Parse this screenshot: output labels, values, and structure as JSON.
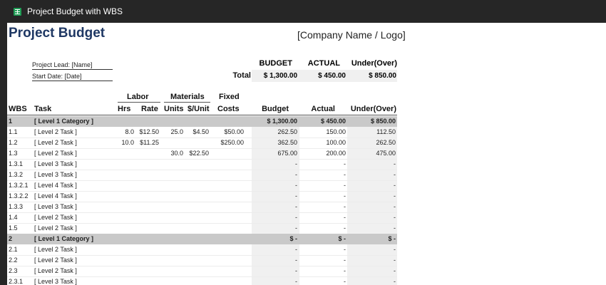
{
  "window": {
    "title": "Project Budget with WBS"
  },
  "sheet": {
    "title": "Project Budget",
    "company": "[Company Name / Logo]",
    "project_lead": "Project Lead: [Name]",
    "start_date": "Start Date: [Date]",
    "summary": {
      "headers": [
        "BUDGET",
        "ACTUAL",
        "Under(Over)"
      ],
      "total_label": "Total",
      "values": [
        "$ 1,300.00",
        "$ 450.00",
        "$ 850.00"
      ]
    },
    "group_headers": {
      "labor": "Labor",
      "materials": "Materials",
      "fixed": "Fixed"
    },
    "columns": [
      "WBS",
      "Task",
      "Hrs",
      "Rate",
      "Units",
      "$/Unit",
      "Costs",
      "Budget",
      "Actual",
      "Under(Over)"
    ],
    "rows": [
      {
        "type": "cat",
        "wbs": "1",
        "task": "[ Level 1 Category ]",
        "hrs": "",
        "rate": "",
        "units": "",
        "unit_cost": "",
        "fixed": "",
        "budget": "$ 1,300.00",
        "actual": "$ 450.00",
        "under": "$ 850.00"
      },
      {
        "type": "task",
        "wbs": "1.1",
        "task": "[ Level 2 Task ]",
        "hrs": "8.0",
        "rate": "$12.50",
        "units": "25.0",
        "unit_cost": "$4.50",
        "fixed": "$50.00",
        "budget": "262.50",
        "actual": "150.00",
        "under": "112.50"
      },
      {
        "type": "task",
        "wbs": "1.2",
        "task": "[ Level 2 Task ]",
        "hrs": "10.0",
        "rate": "$11.25",
        "units": "",
        "unit_cost": "",
        "fixed": "$250.00",
        "budget": "362.50",
        "actual": "100.00",
        "under": "262.50"
      },
      {
        "type": "task",
        "wbs": "1.3",
        "task": "[ Level 2 Task ]",
        "hrs": "",
        "rate": "",
        "units": "30.0",
        "unit_cost": "$22.50",
        "fixed": "",
        "budget": "675.00",
        "actual": "200.00",
        "under": "475.00"
      },
      {
        "type": "task",
        "wbs": "1.3.1",
        "task": "[ Level 3 Task ]",
        "hrs": "",
        "rate": "",
        "units": "",
        "unit_cost": "",
        "fixed": "",
        "budget": "-",
        "actual": "-",
        "under": "-"
      },
      {
        "type": "task",
        "wbs": "1.3.2",
        "task": "[ Level 3 Task ]",
        "hrs": "",
        "rate": "",
        "units": "",
        "unit_cost": "",
        "fixed": "",
        "budget": "-",
        "actual": "-",
        "under": "-"
      },
      {
        "type": "task",
        "wbs": "1.3.2.1",
        "task": "[ Level 4 Task ]",
        "hrs": "",
        "rate": "",
        "units": "",
        "unit_cost": "",
        "fixed": "",
        "budget": "-",
        "actual": "-",
        "under": "-"
      },
      {
        "type": "task",
        "wbs": "1.3.2.2",
        "task": "[ Level 4 Task ]",
        "hrs": "",
        "rate": "",
        "units": "",
        "unit_cost": "",
        "fixed": "",
        "budget": "-",
        "actual": "-",
        "under": "-"
      },
      {
        "type": "task",
        "wbs": "1.3.3",
        "task": "[ Level 3 Task ]",
        "hrs": "",
        "rate": "",
        "units": "",
        "unit_cost": "",
        "fixed": "",
        "budget": "-",
        "actual": "-",
        "under": "-"
      },
      {
        "type": "task",
        "wbs": "1.4",
        "task": "[ Level 2 Task ]",
        "hrs": "",
        "rate": "",
        "units": "",
        "unit_cost": "",
        "fixed": "",
        "budget": "-",
        "actual": "-",
        "under": "-"
      },
      {
        "type": "task",
        "wbs": "1.5",
        "task": "[ Level 2 Task ]",
        "hrs": "",
        "rate": "",
        "units": "",
        "unit_cost": "",
        "fixed": "",
        "budget": "-",
        "actual": "-",
        "under": "-"
      },
      {
        "type": "cat",
        "wbs": "2",
        "task": "[ Level 1 Category ]",
        "hrs": "",
        "rate": "",
        "units": "",
        "unit_cost": "",
        "fixed": "",
        "budget": "$ -",
        "actual": "$ -",
        "under": "$ -"
      },
      {
        "type": "task",
        "wbs": "2.1",
        "task": "[ Level 2 Task ]",
        "hrs": "",
        "rate": "",
        "units": "",
        "unit_cost": "",
        "fixed": "",
        "budget": "-",
        "actual": "-",
        "under": "-"
      },
      {
        "type": "task",
        "wbs": "2.2",
        "task": "[ Level 2 Task ]",
        "hrs": "",
        "rate": "",
        "units": "",
        "unit_cost": "",
        "fixed": "",
        "budget": "-",
        "actual": "-",
        "under": "-"
      },
      {
        "type": "task",
        "wbs": "2.3",
        "task": "[ Level 2 Task ]",
        "hrs": "",
        "rate": "",
        "units": "",
        "unit_cost": "",
        "fixed": "",
        "budget": "-",
        "actual": "-",
        "under": "-"
      },
      {
        "type": "task",
        "wbs": "2.3.1",
        "task": "[ Level 3 Task ]",
        "hrs": "",
        "rate": "",
        "units": "",
        "unit_cost": "",
        "fixed": "",
        "budget": "-",
        "actual": "-",
        "under": "-"
      }
    ]
  }
}
